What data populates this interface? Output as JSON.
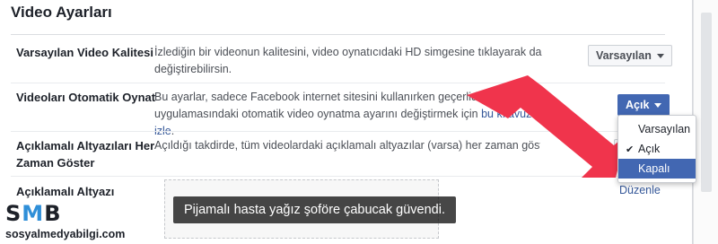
{
  "panel": {
    "title": "Video Ayarları"
  },
  "rows": [
    {
      "label": "Varsayılan Video Kalitesi",
      "desc": "İzlediğin bir videonun kalitesini, video oynatıcıdaki HD simgesine tıklayarak da değiştirebilirsin.",
      "button": "Varsayılan"
    },
    {
      "label": "Videoları Otomatik Oynat",
      "desc_part1": "Bu ayarlar, sadece Facebook internet sitesini kullanırken geçerlidir. Facebook uygulamasındaki otomatik video oynatma ayarını değiştirmek için ",
      "desc_link": "bu kılavuzu izle",
      "desc_part2": ".",
      "button": "Açık"
    },
    {
      "label_line1": "Açıklamalı Altyazıları Her",
      "label_line2": "Zaman Göster",
      "desc": "Açıldığı takdirde, tüm videolardaki açıklamalı altyazılar (varsa) her zaman gösterilir."
    },
    {
      "label": "Açıklamalı Altyazı",
      "edit": "Düzenle"
    }
  ],
  "dropdown": {
    "options": [
      "Varsayılan",
      "Açık",
      "Kapalı"
    ],
    "checked": "Açık",
    "highlighted": "Kapalı",
    "check_glyph": "✔"
  },
  "caption": {
    "text": "Pijamalı hasta yağız şoföre çabucak güvendi."
  },
  "watermark": {
    "s": "S",
    "m": "M",
    "b": "B",
    "site": "sosyalmedyabilgi.com"
  },
  "colors": {
    "accent": "#4267b2",
    "arrow": "#f0344c",
    "link": "#365899"
  }
}
